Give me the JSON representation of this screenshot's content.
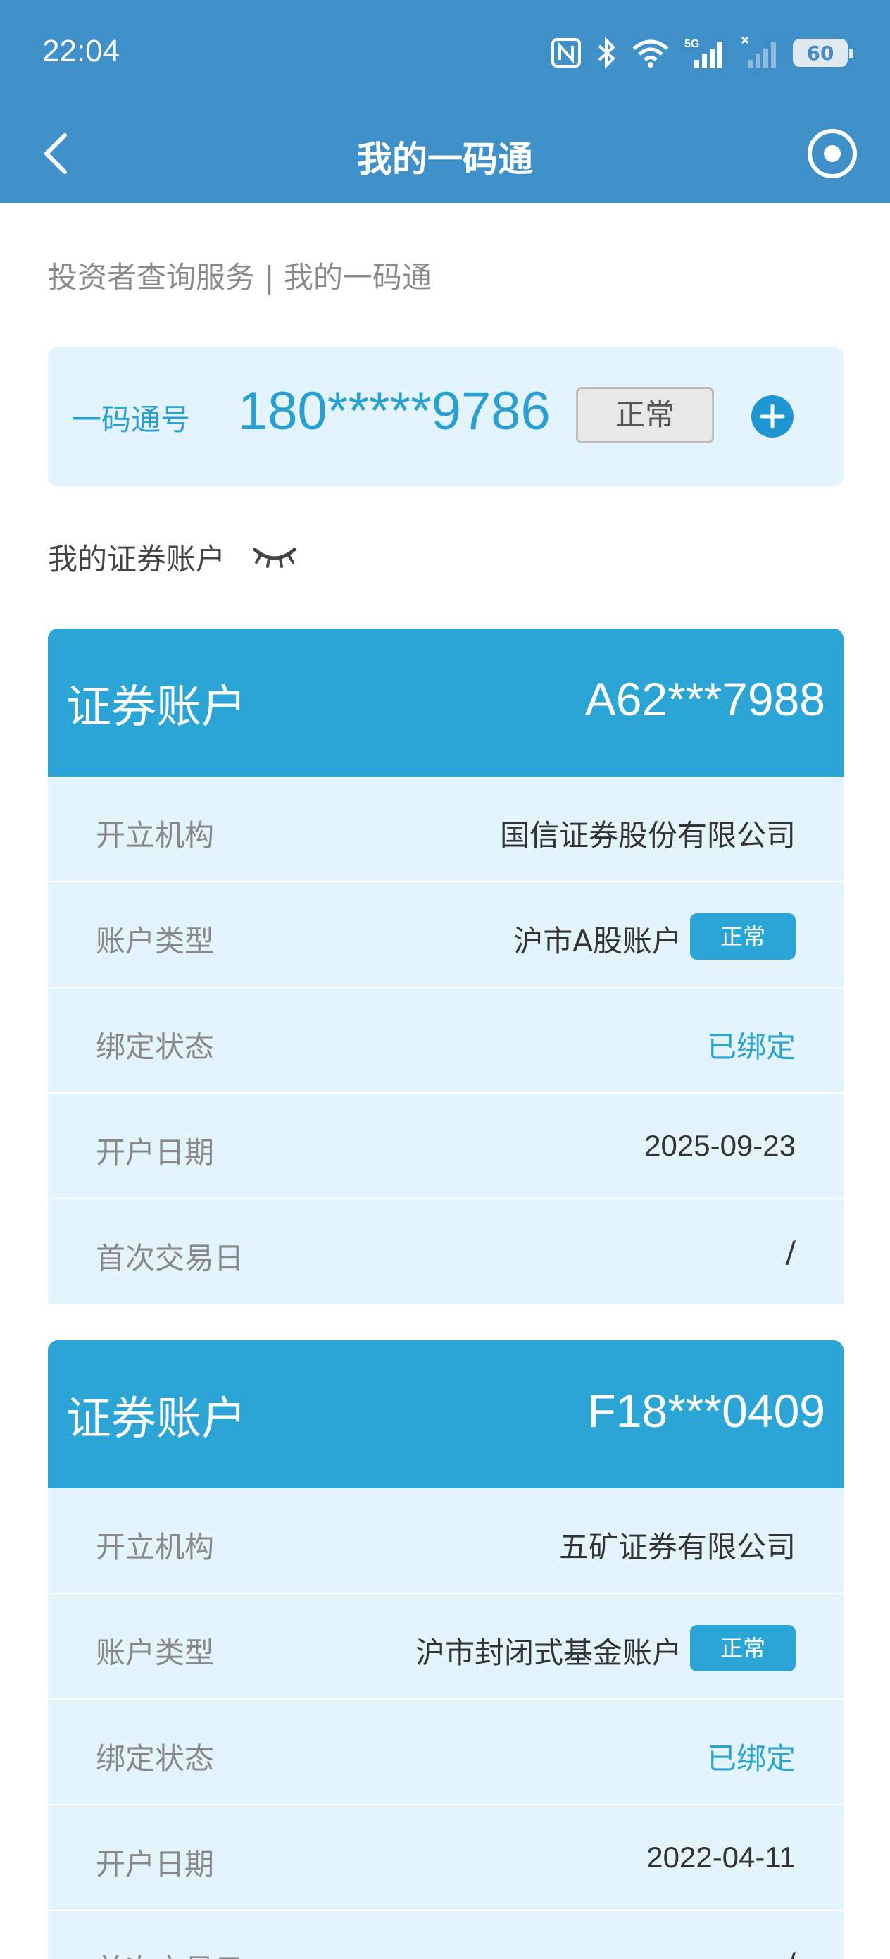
{
  "status_bar": {
    "time": "22:04",
    "network": "5G",
    "battery": "60"
  },
  "header": {
    "title": "我的一码通"
  },
  "subtitle": "投资者查询服务 | 我的一码通",
  "code_card": {
    "label": "一码通号",
    "number": "180*****9786",
    "status": "正常"
  },
  "section_title": "我的证券账户",
  "accounts": [
    {
      "title": "证券账户",
      "number": "A62***7988",
      "rows": {
        "institution_label": "开立机构",
        "institution": "国信证券股份有限公司",
        "type_label": "账户类型",
        "type": "沪市A股账户",
        "type_status": "正常",
        "bind_label": "绑定状态",
        "bind": "已绑定",
        "open_label": "开户日期",
        "open_date": "2025-09-23",
        "first_trade_label": "首次交易日",
        "first_trade": "/"
      }
    },
    {
      "title": "证券账户",
      "number": "F18***0409",
      "rows": {
        "institution_label": "开立机构",
        "institution": "五矿证券有限公司",
        "type_label": "账户类型",
        "type": "沪市封闭式基金账户",
        "type_status": "正常",
        "bind_label": "绑定状态",
        "bind": "已绑定",
        "open_label": "开户日期",
        "open_date": "2022-04-11",
        "first_trade_label": "首次交易日",
        "first_trade": "/"
      }
    }
  ]
}
